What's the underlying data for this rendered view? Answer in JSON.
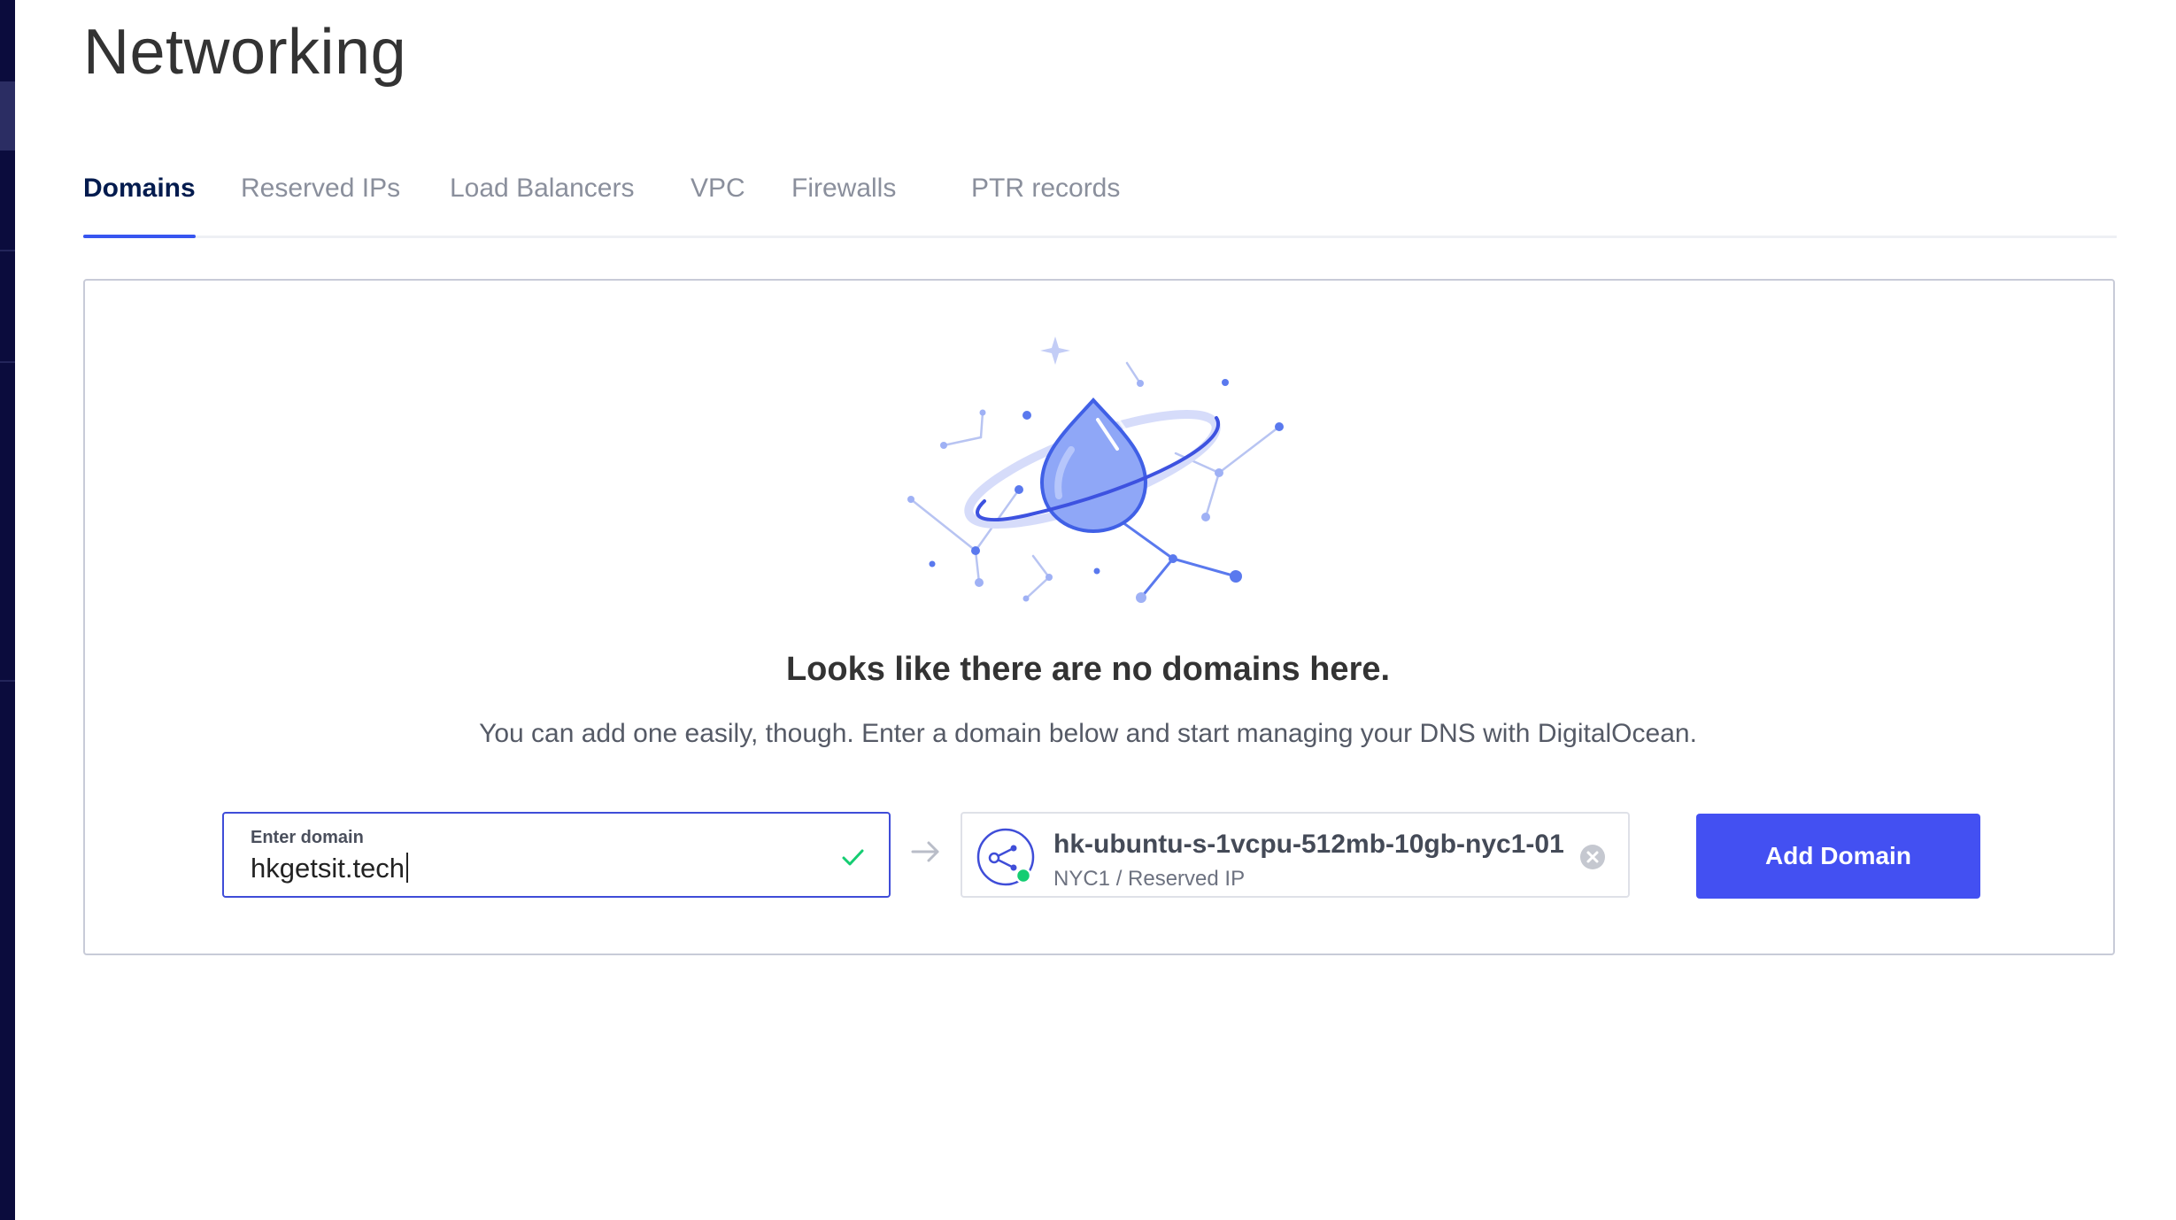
{
  "page": {
    "title": "Networking"
  },
  "tabs": [
    {
      "label": "Domains",
      "active": true
    },
    {
      "label": "Reserved IPs",
      "active": false
    },
    {
      "label": "Load Balancers",
      "active": false
    },
    {
      "label": "VPC",
      "active": false
    },
    {
      "label": "Firewalls",
      "active": false
    },
    {
      "label": "PTR records",
      "active": false
    }
  ],
  "empty_state": {
    "heading": "Looks like there are no domains here.",
    "subtext": "You can add one easily, though. Enter a domain below and start managing your DNS with DigitalOcean.",
    "illustration_icon": "planet-droplet-icon"
  },
  "domain_form": {
    "input_label": "Enter domain",
    "input_value": "hkgetsit.tech",
    "valid_icon": "check-icon",
    "arrow_icon": "arrow-right-icon",
    "resource": {
      "name": "hk-ubuntu-s-1vcpu-512mb-10gb-nyc1-01",
      "meta": "NYC1 / Reserved IP",
      "icon": "reserved-ip-icon",
      "status": "active",
      "clear_icon": "clear-circle-icon"
    },
    "submit_label": "Add Domain"
  },
  "colors": {
    "primary": "#4350f2",
    "tab_active_underline": "#3755f0",
    "sidebar": "#0b0c3d",
    "valid": "#15cd72",
    "status_active": "#15cd72"
  }
}
